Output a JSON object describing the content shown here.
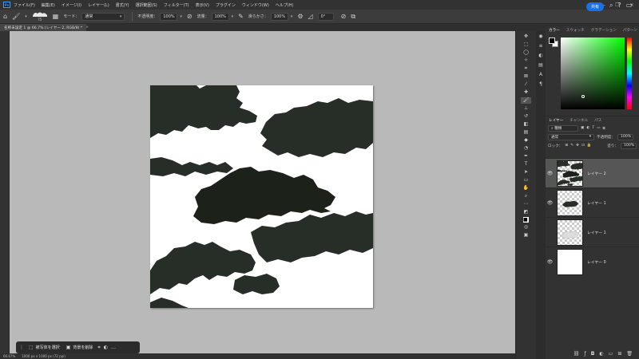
{
  "menubar": {
    "items": [
      "ファイル(F)",
      "編集(E)",
      "イメージ(I)",
      "レイヤー(L)",
      "書式(Y)",
      "選択範囲(S)",
      "フィルター(T)",
      "表示(V)",
      "プラグイン",
      "ウィンドウ(W)",
      "ヘルプ(H)"
    ],
    "logo": "Ps"
  },
  "options": {
    "brush_size": "75",
    "mode_label": "モード：",
    "mode_value": "通常",
    "opacity_label": "不透明度：",
    "opacity_value": "100%",
    "flow_label": "流量：",
    "flow_value": "100%",
    "smoothing_label": "滑らかさ：",
    "smoothing_value": "100%",
    "angle_value": "0°",
    "share_label": "共有"
  },
  "document": {
    "tab_title": "名称未設定 1 @ 66.7% (レイヤー 2, RGB/8) *",
    "close_glyph": "×"
  },
  "statusbar": {
    "zoom": "66.67%",
    "doc_size": "1000 px x 1000 px (72 ppi)"
  },
  "taskbar": {
    "select_subject": "被写体を選択",
    "remove_bg": "背景を削除",
    "more": "…"
  },
  "color_panel": {
    "tabs": [
      "カラー",
      "スウォッチ",
      "グラデーション",
      "パターン"
    ],
    "foreground": "#000000",
    "background": "#ffffff"
  },
  "layers_panel": {
    "tabs": [
      "レイヤー",
      "チャンネル",
      "パス"
    ],
    "filter_label": "種類",
    "blend_mode": "通常",
    "opacity_label": "不透明度：",
    "opacity_value": "100%",
    "lock_label": "ロック：",
    "fill_label": "塗り：",
    "fill_value": "100%",
    "layers": [
      {
        "name": "レイヤー 2",
        "visible": true,
        "selected": true
      },
      {
        "name": "レイヤー 1",
        "visible": true,
        "selected": false
      },
      {
        "name": "レイヤー 1",
        "visible": false,
        "selected": false
      },
      {
        "name": "レイヤー 0",
        "visible": true,
        "selected": false
      }
    ]
  },
  "canvas": {
    "cloud_color": "#262e27",
    "cloud_color_dark": "#1c2219"
  }
}
